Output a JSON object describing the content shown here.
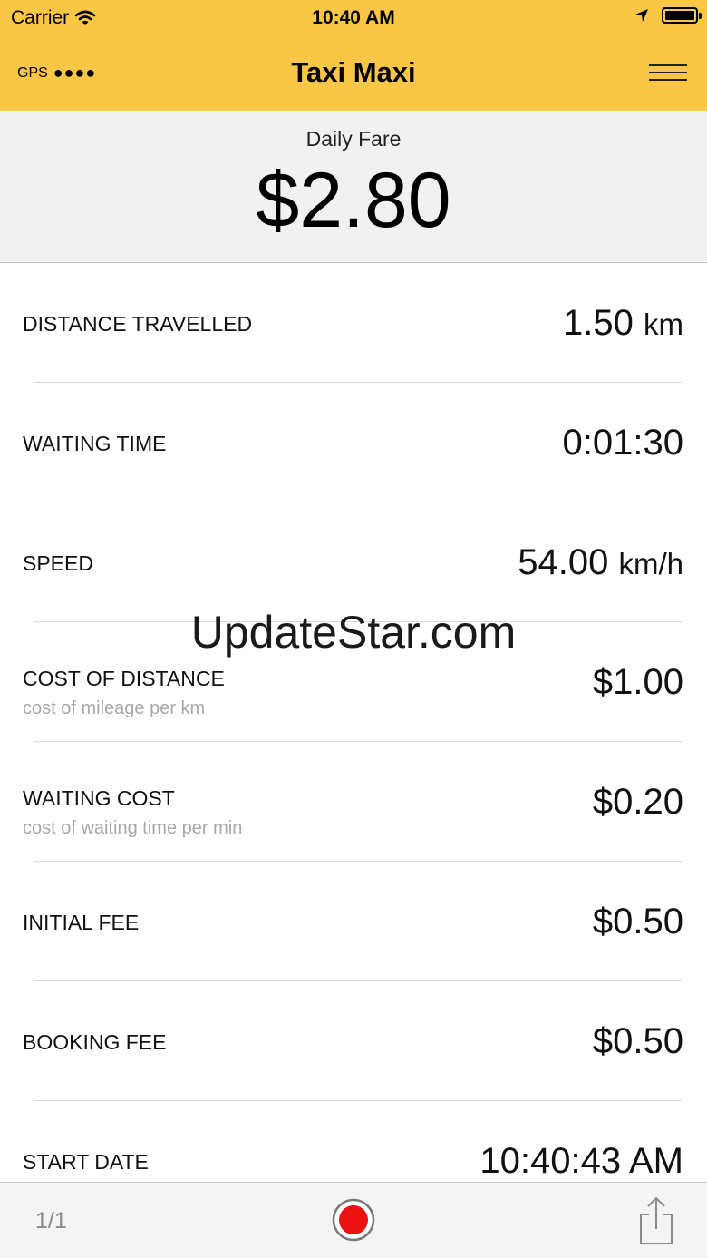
{
  "status_bar": {
    "carrier": "Carrier",
    "time": "10:40 AM"
  },
  "nav": {
    "gps_label": "GPS",
    "gps_signal": "●●●●",
    "title": "Taxi Maxi"
  },
  "fare": {
    "label": "Daily Fare",
    "value": "$2.80"
  },
  "rows": [
    {
      "label": "DISTANCE TRAVELLED",
      "value": "1.50",
      "unit": "km"
    },
    {
      "label": "WAITING TIME",
      "value": "0:01:30"
    },
    {
      "label": "SPEED",
      "value": "54.00",
      "unit": "km/h"
    },
    {
      "label": "COST OF DISTANCE",
      "sub": "cost of mileage per km",
      "value": "$1.00"
    },
    {
      "label": "WAITING COST",
      "sub": "cost of waiting time per min",
      "value": "$0.20"
    },
    {
      "label": "INITIAL FEE",
      "value": "$0.50"
    },
    {
      "label": "BOOKING FEE",
      "value": "$0.50"
    },
    {
      "label": "START DATE",
      "value": "10:40:43 AM"
    }
  ],
  "watermark": "UpdateStar.com",
  "toolbar": {
    "page_indicator": "1/1"
  },
  "colors": {
    "accent": "#f9c646",
    "record": "#ee1111"
  }
}
